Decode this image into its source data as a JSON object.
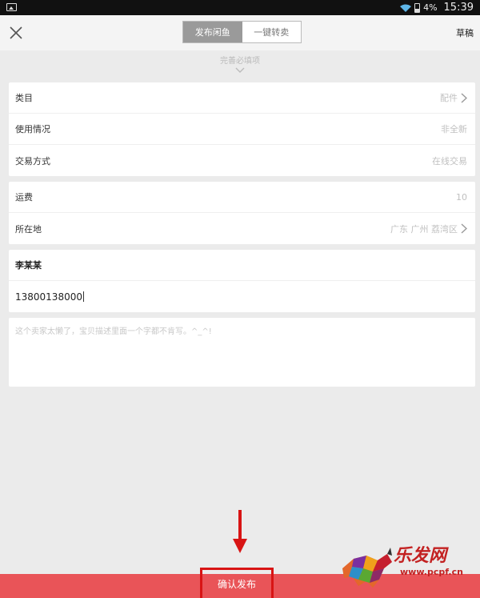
{
  "status_bar": {
    "battery": "4%",
    "time": "15:39"
  },
  "header": {
    "tabs": [
      {
        "label": "发布闲鱼",
        "active": true
      },
      {
        "label": "一键转卖",
        "active": false
      }
    ],
    "draft_label": "草稿"
  },
  "hint": {
    "text": "完善必填项"
  },
  "section1": {
    "rows": [
      {
        "label": "类目",
        "value": "配件"
      },
      {
        "label": "使用情况",
        "value": "非全新"
      },
      {
        "label": "交易方式",
        "value": "在线交易"
      }
    ]
  },
  "section2": {
    "rows": [
      {
        "label": "运费",
        "value": "10"
      },
      {
        "label": "所在地",
        "value": "广东 广州 荔湾区"
      }
    ]
  },
  "contact": {
    "name": "李某某",
    "phone": "13800138000"
  },
  "description": {
    "placeholder": "这个卖家太懒了，宝贝描述里面一个字都不肯写。^_^!"
  },
  "footer": {
    "confirm_label": "确认发布"
  },
  "watermark": {
    "title": "乐发网",
    "url": "www.pcpf.cn"
  },
  "colors": {
    "accent": "#e95458",
    "annotation": "#d81414",
    "segment_active": "#9a9a9a"
  }
}
